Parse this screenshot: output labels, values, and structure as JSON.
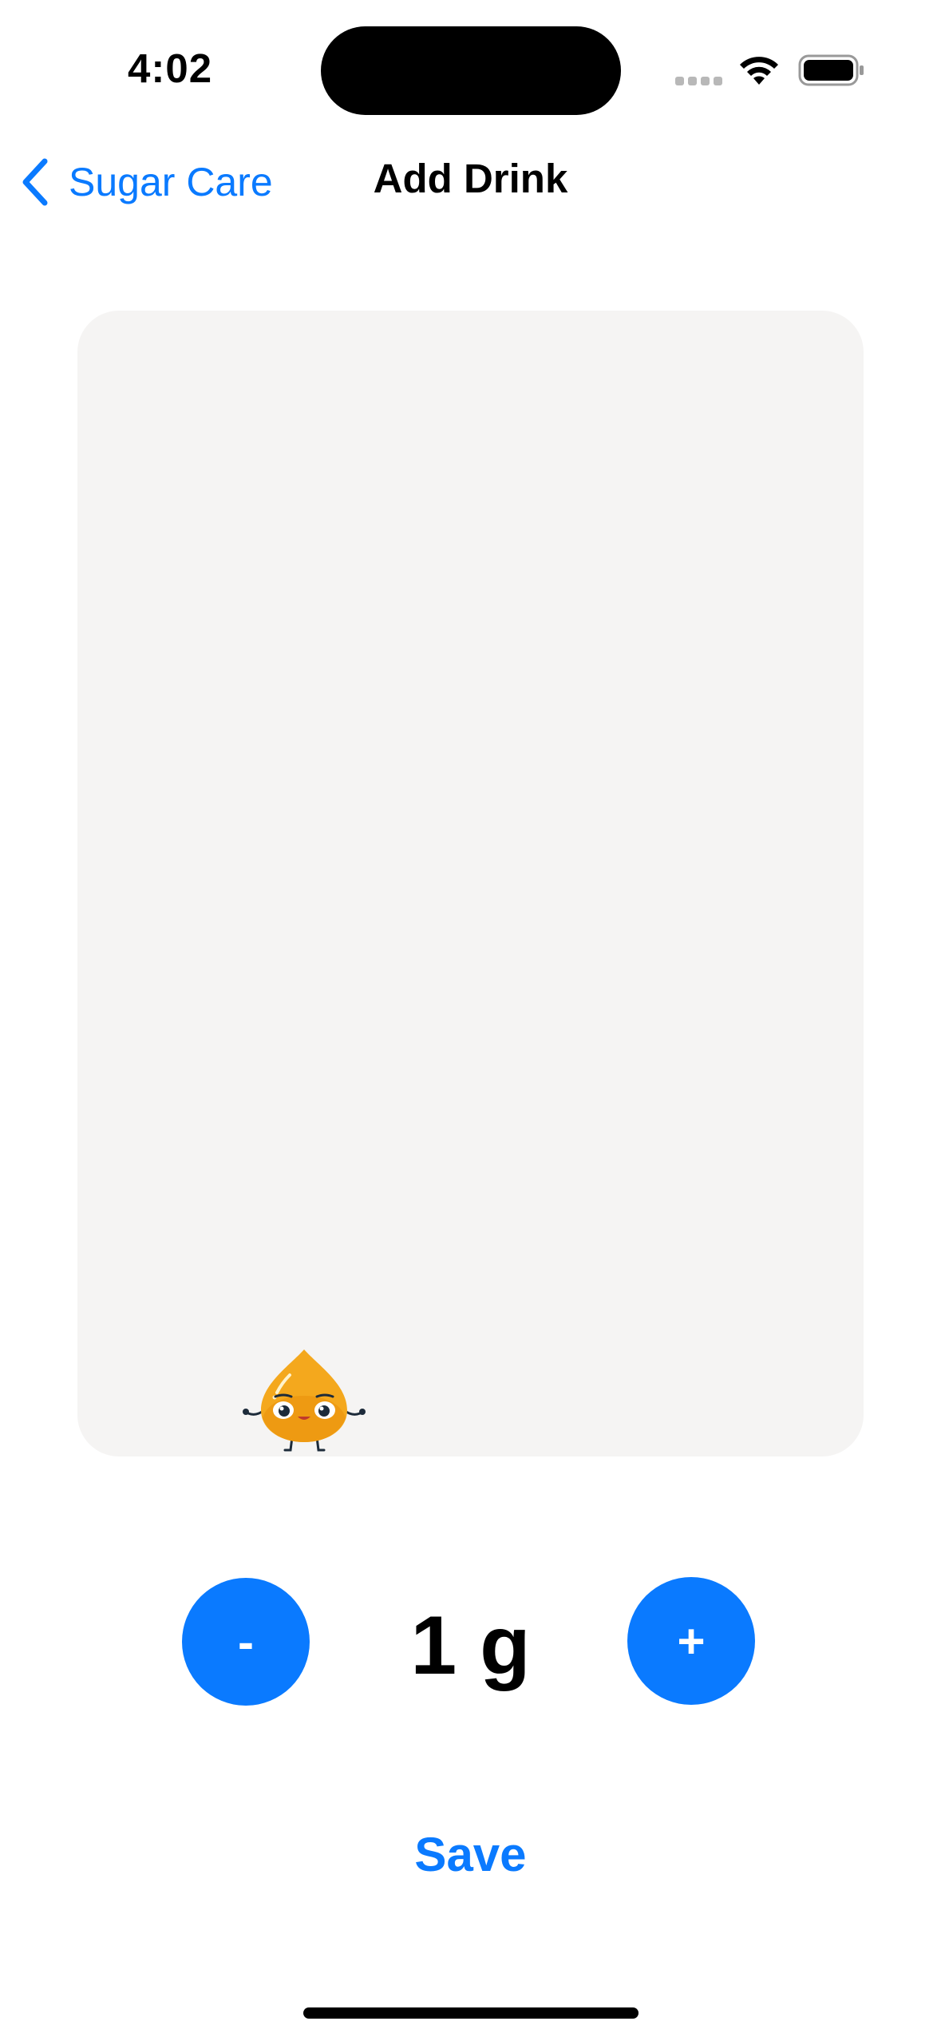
{
  "status_bar": {
    "time": "4:02",
    "icons": [
      "signal-dots-icon",
      "wifi-icon",
      "battery-icon"
    ]
  },
  "nav": {
    "back_label": "Sugar Care",
    "title": "Add Drink"
  },
  "stepper": {
    "decrement_label": "-",
    "value": "1 g",
    "increment_label": "+"
  },
  "actions": {
    "save_label": "Save"
  },
  "colors": {
    "accent": "#0a7aff",
    "card_background": "#f5f4f3",
    "mascot": "#f4a81d"
  }
}
